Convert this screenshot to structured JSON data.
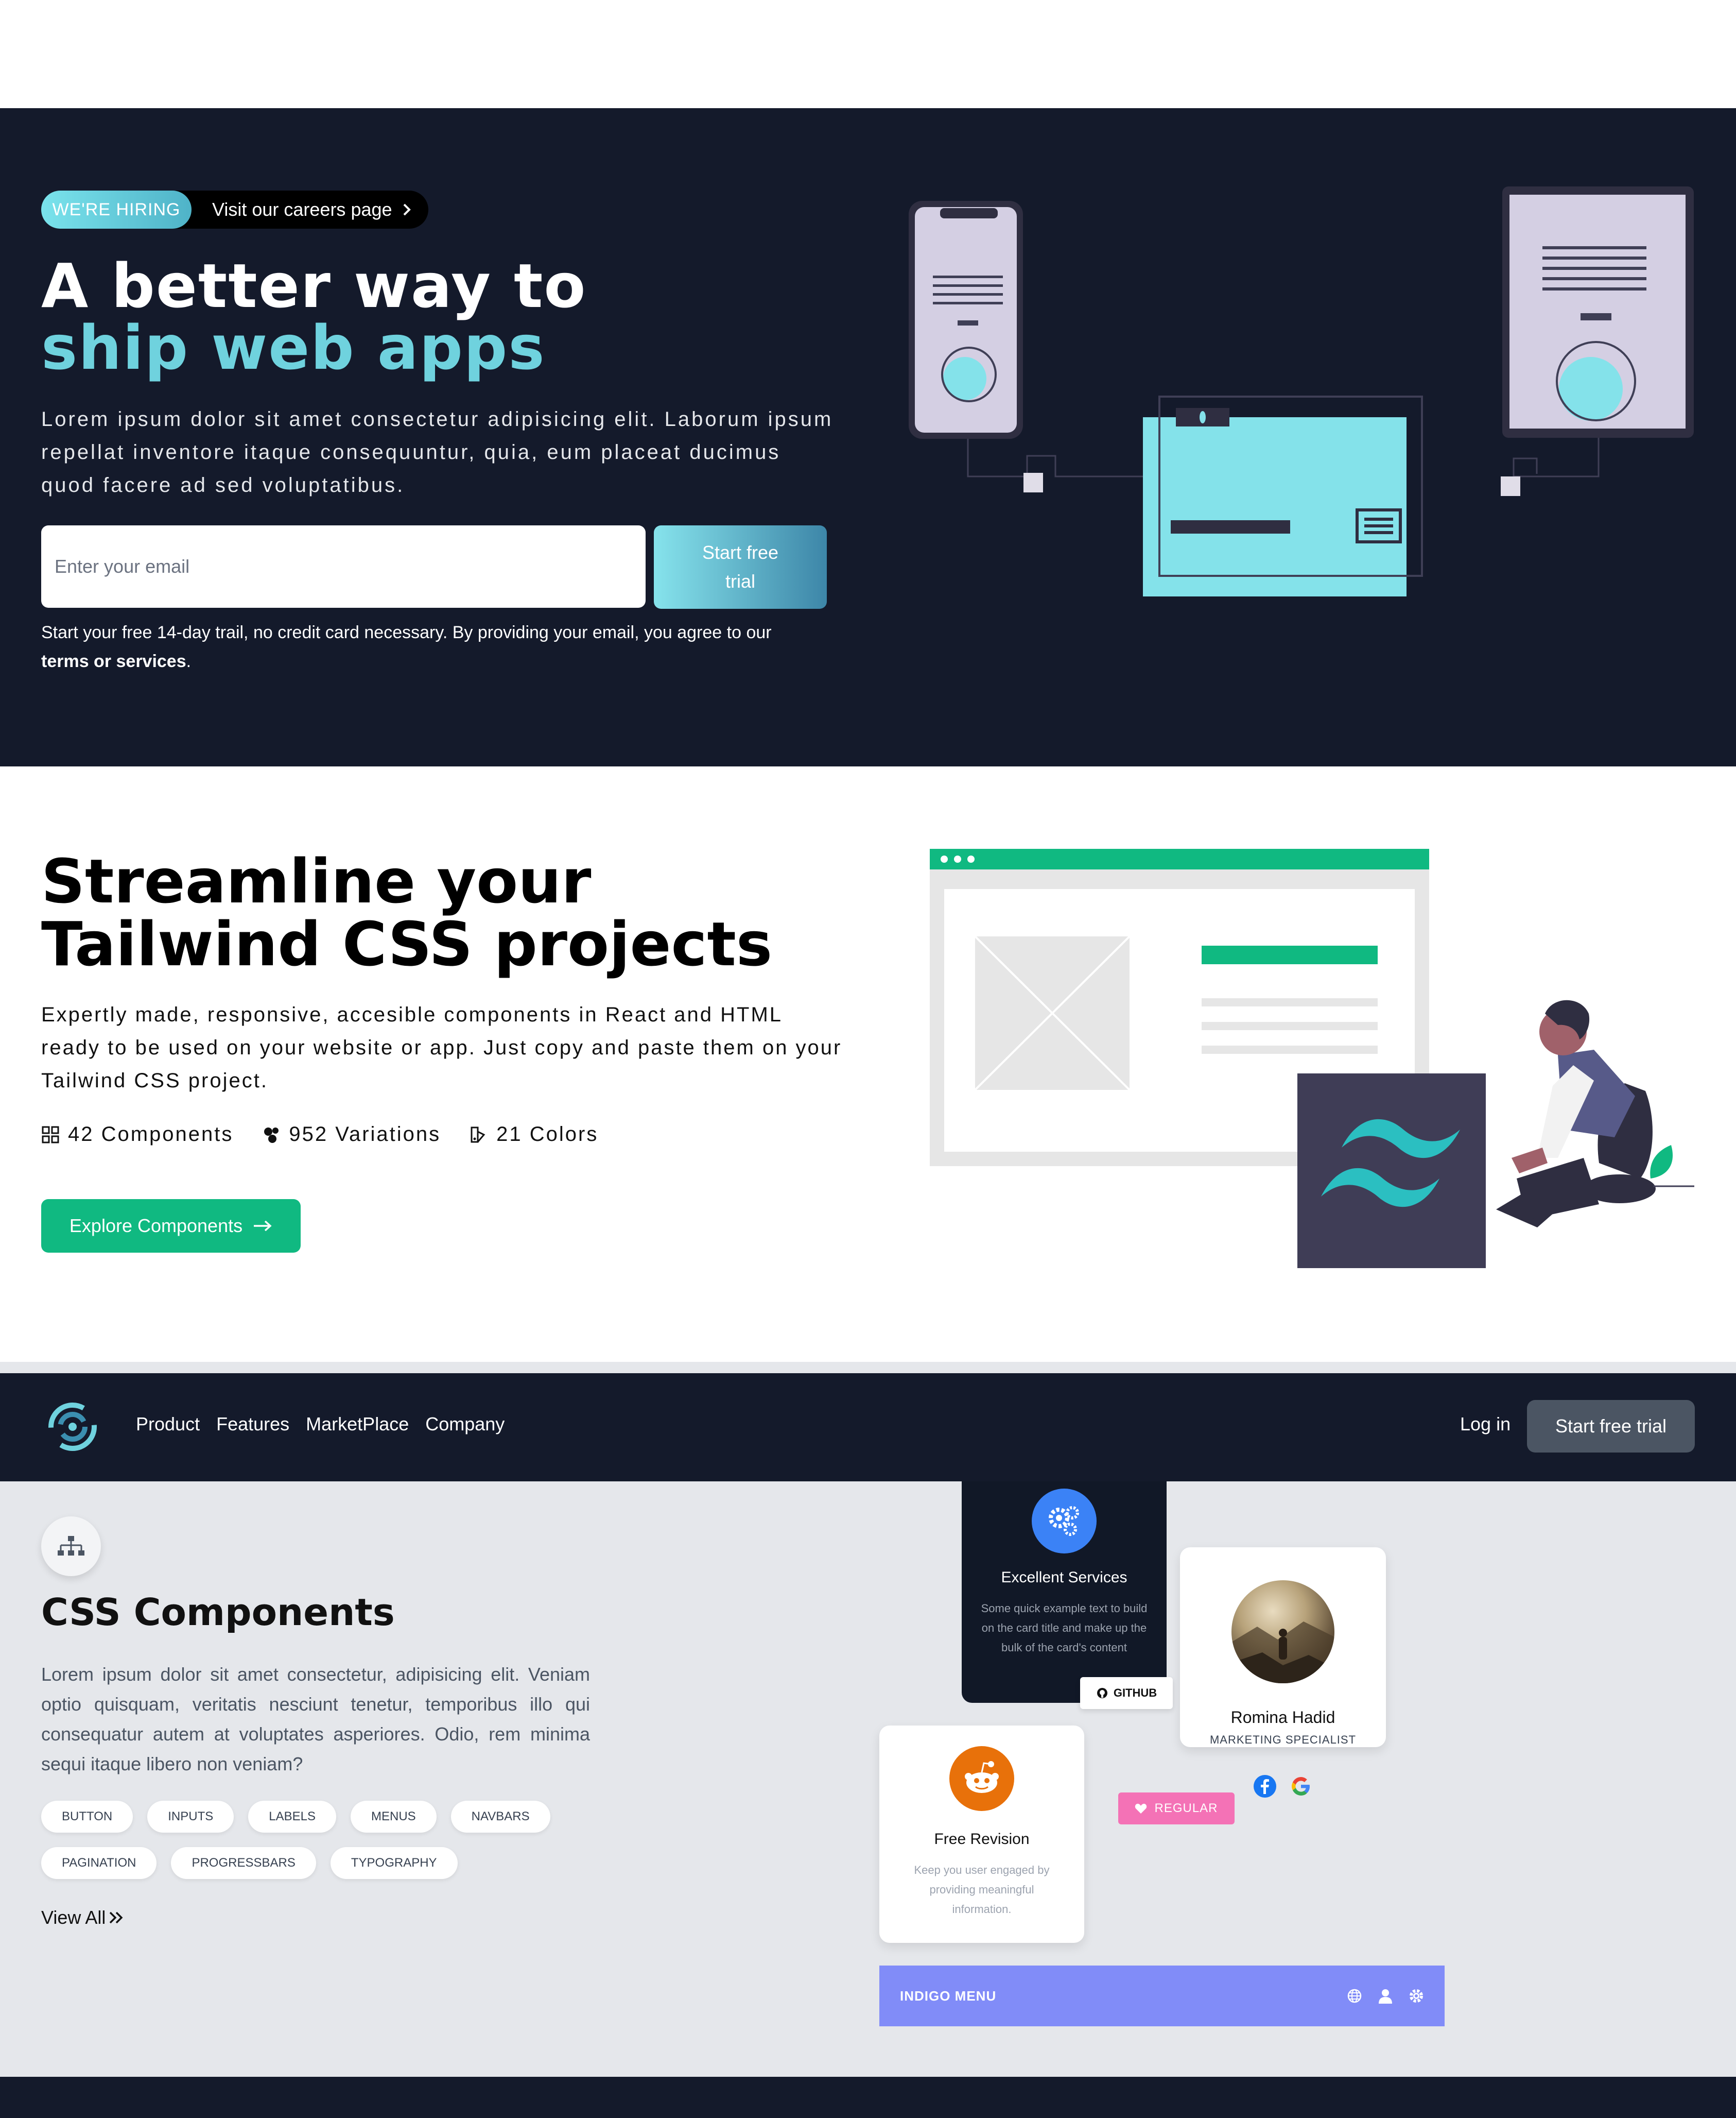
{
  "hero": {
    "badge": "WE'RE HIRING",
    "careers_link": "Visit our careers page",
    "title_line1": "A better way to",
    "title_line2": "ship web apps",
    "description": "Lorem ipsum dolor sit amet consectetur adipisicing elit. Laborum ipsum repellat inventore itaque consequuntur, quia, eum placeat ducimus quod facere ad sed voluptatibus.",
    "email_placeholder": "Enter your email",
    "cta_label": "Start free trial",
    "note": "Start your free 14-day trail, no credit card necessary. By providing your email, you agree to our",
    "note_link": "terms or services",
    "note_end": "."
  },
  "streamline": {
    "title": "Streamline your Tailwind CSS projects",
    "description": "Expertly made, responsive, accesible components in React and HTML ready to be used on your website or app. Just copy and paste them on your Tailwind CSS project.",
    "stats": [
      {
        "icon": "components-icon",
        "label": "42 Components"
      },
      {
        "icon": "variations-icon",
        "label": "952 Variations"
      },
      {
        "icon": "colors-icon",
        "label": "21 Colors"
      }
    ],
    "cta_label": "Explore Components"
  },
  "nav": {
    "links": [
      "Product",
      "Features",
      "MarketPlace",
      "Company"
    ],
    "login": "Log in",
    "cta_label": "Start free trial"
  },
  "components": {
    "title": "CSS Components",
    "description": "Lorem ipsum dolor sit amet consectetur, adipisicing elit. Veniam optio quisquam, veritatis nesciunt tenetur, temporibus illo qui consequatur autem at voluptates asperiores. Odio, rem minima sequi itaque libero non veniam?",
    "tags": [
      "BUTTON",
      "INPUTS",
      "LABELS",
      "MENUS",
      "NAVBARS",
      "PAGINATION",
      "PROGRESSBARS",
      "TYPOGRAPHY"
    ],
    "view_all": "View All",
    "card_services": {
      "title": "Excellent Services",
      "text": "Some quick example text to build on the card title and make up the bulk of the card's content",
      "tag": "GITHUB"
    },
    "card_profile": {
      "name": "Romina Hadid",
      "role": "MARKETING SPECIALIST",
      "tag": "REGULAR"
    },
    "card_revision": {
      "title": "Free Revision",
      "text": "Keep you user engaged by providing meaningful information."
    },
    "menu": {
      "title": "INDIGO MENU"
    }
  },
  "colors": {
    "navy": "#141a2b",
    "cyan": "#6fd2de",
    "green": "#10b981",
    "indigo": "#818cf8",
    "pink": "#f472b6",
    "blue": "#3b82f6",
    "orange": "#e8710a"
  }
}
